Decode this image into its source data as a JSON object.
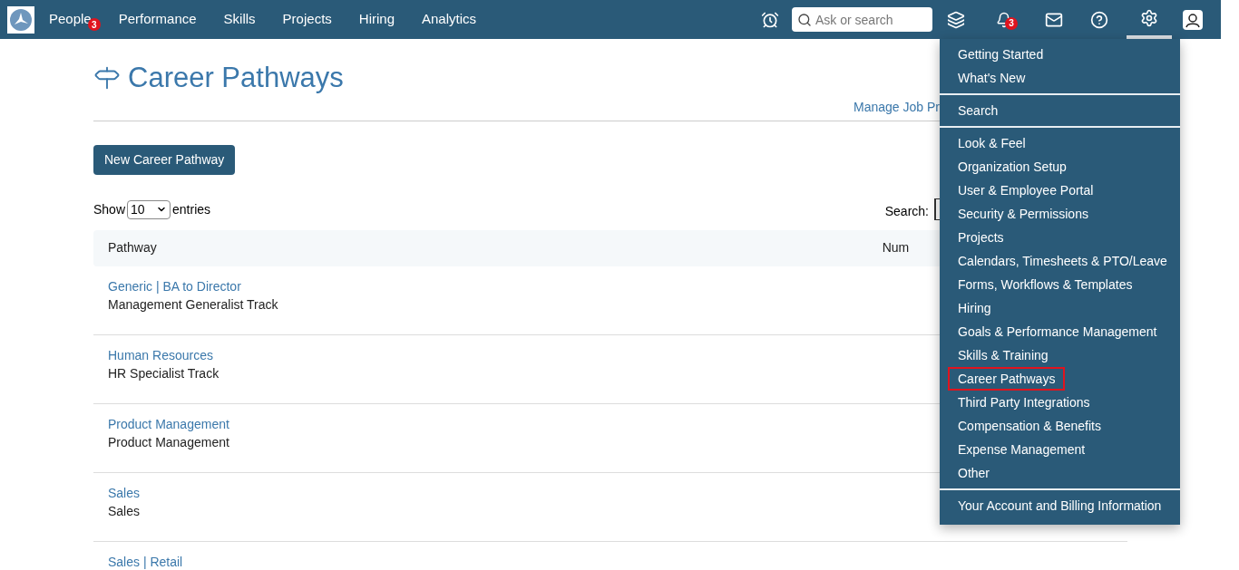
{
  "nav": {
    "items": [
      {
        "label": "People",
        "badge": "3"
      },
      {
        "label": "Performance"
      },
      {
        "label": "Skills"
      },
      {
        "label": "Projects"
      },
      {
        "label": "Hiring"
      },
      {
        "label": "Analytics"
      }
    ],
    "search": {
      "placeholder": "Ask or search"
    },
    "notifications_badge": "3"
  },
  "page": {
    "title": "Career Pathways",
    "manage_link": "Manage Job Pr",
    "new_button": "New Career Pathway",
    "show_label": "Show",
    "entries_value": "10",
    "entries_label": "entries",
    "search_label": "Search:"
  },
  "table": {
    "columns": [
      "Pathway",
      "Num"
    ],
    "rows": [
      {
        "name": "Generic | BA to Director",
        "track": "Management Generalist Track"
      },
      {
        "name": "Human Resources",
        "track": "HR Specialist Track"
      },
      {
        "name": "Product Management",
        "track": "Product Management"
      },
      {
        "name": "Sales",
        "track": "Sales"
      },
      {
        "name": "Sales | Retail"
      }
    ]
  },
  "settings_menu": {
    "groups": [
      [
        {
          "label": "Getting Started",
          "selected": false
        },
        {
          "label": "What's New",
          "selected": false
        }
      ],
      [
        {
          "label": "Search",
          "selected": false
        }
      ],
      [
        {
          "label": "Look & Feel",
          "selected": false
        },
        {
          "label": "Organization Setup",
          "selected": false
        },
        {
          "label": "User & Employee Portal",
          "selected": false
        },
        {
          "label": "Security & Permissions",
          "selected": false
        },
        {
          "label": "Projects",
          "selected": false
        },
        {
          "label": "Calendars, Timesheets & PTO/Leave",
          "selected": false
        },
        {
          "label": "Forms, Workflows & Templates",
          "selected": false
        },
        {
          "label": "Hiring",
          "selected": false
        },
        {
          "label": "Goals & Performance Management",
          "selected": false
        },
        {
          "label": "Skills & Training",
          "selected": false
        },
        {
          "label": "Career Pathways",
          "selected": true
        },
        {
          "label": "Third Party Integrations",
          "selected": false
        },
        {
          "label": "Compensation & Benefits",
          "selected": false
        },
        {
          "label": "Expense Management",
          "selected": false
        },
        {
          "label": "Other",
          "selected": false
        }
      ],
      [
        {
          "label": "Your Account and Billing Information",
          "selected": false
        }
      ]
    ]
  }
}
